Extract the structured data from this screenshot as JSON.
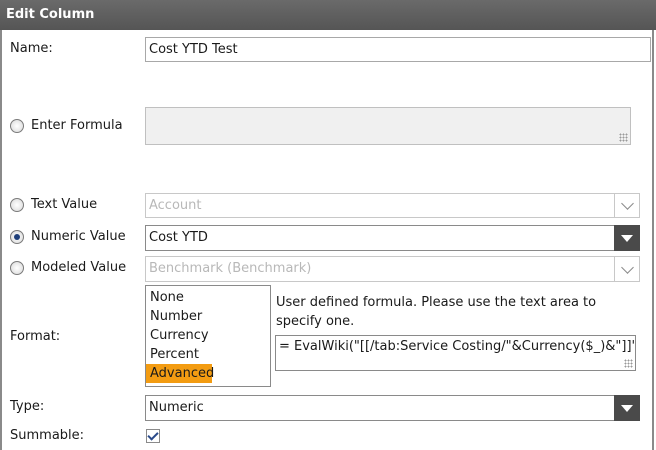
{
  "title": "Edit Column",
  "name": {
    "label": "Name:",
    "value": "Cost YTD Test"
  },
  "formula": {
    "label": "Enter Formula",
    "value": ""
  },
  "text_value": {
    "label": "Text Value",
    "selected": "Account"
  },
  "numeric_value": {
    "label": "Numeric Value",
    "selected": "Cost YTD"
  },
  "modeled_value": {
    "label": "Modeled Value",
    "selected": "Benchmark (Benchmark)"
  },
  "format": {
    "label": "Format:",
    "options": [
      "None",
      "Number",
      "Currency",
      "Percent",
      "Advanced"
    ],
    "selected": "Advanced",
    "help_text": "User defined formula. Please use the text area to specify one.",
    "formula_value": "= EvalWiki(\"[[/tab:Service Costing/\"&Currency($_)&\"]]\")"
  },
  "type": {
    "label": "Type:",
    "selected": "Numeric"
  },
  "summable": {
    "label": "Summable:",
    "checked": true
  },
  "selected_radio": "numeric_value",
  "colors": {
    "titlebar": "#555555",
    "highlight": "#f39c12",
    "dropdown_button": "#4a4a4a"
  }
}
